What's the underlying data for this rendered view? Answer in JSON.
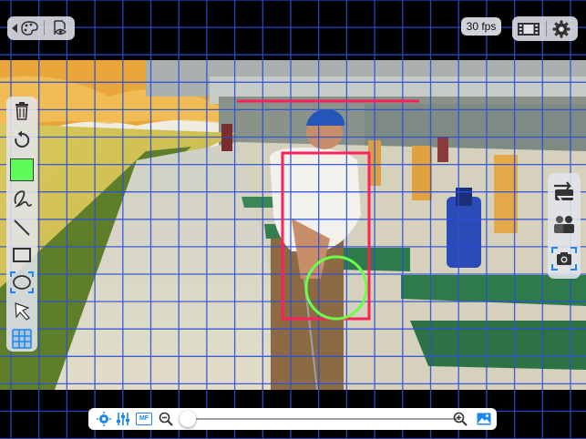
{
  "top_bar": {
    "left_group": {
      "back_icon": "back-arrow-icon",
      "palette_icon": "palette-icon",
      "visibility_icon": "document-eye-icon"
    },
    "fps_label": "30 fps",
    "right_group": {
      "film_icon": "film-strip-icon",
      "settings_icon": "gear-icon"
    }
  },
  "drawing_tools": {
    "items": [
      {
        "name": "trash",
        "icon": "trash-icon"
      },
      {
        "name": "undo",
        "icon": "undo-icon"
      },
      {
        "name": "color",
        "icon": "color-swatch",
        "color": "#5dfc5a"
      },
      {
        "name": "freehand",
        "icon": "freehand-icon"
      },
      {
        "name": "line",
        "icon": "line-icon"
      },
      {
        "name": "rectangle",
        "icon": "rectangle-icon"
      },
      {
        "name": "ellipse",
        "icon": "ellipse-icon",
        "selected": true
      },
      {
        "name": "pointer",
        "icon": "pointer-icon"
      },
      {
        "name": "grid",
        "icon": "grid-icon",
        "selected": true
      }
    ]
  },
  "right_tools": {
    "items": [
      "flip-camera-icon",
      "compare-icon",
      "snapshot-icon"
    ]
  },
  "bottom_bar": {
    "icons": [
      "exposure-icon",
      "sliders-icon",
      "manual-focus-icon",
      "zoom-out-icon",
      "zoom-in-icon",
      "image-icon"
    ],
    "manual_focus_label": "MF",
    "zoom_level": 0.0
  },
  "overlay": {
    "grid_color": "#2a4fd8",
    "rectangle_color": "#ff1f5a",
    "ellipse_color": "#6bff4a",
    "accent_color": "#1c86f2"
  }
}
